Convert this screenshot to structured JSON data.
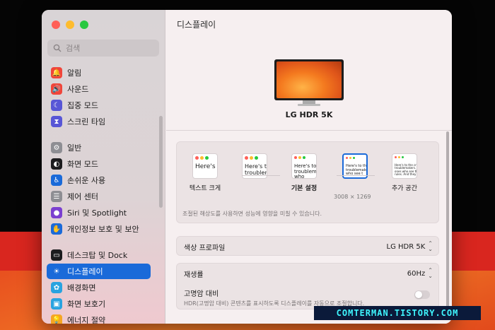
{
  "window": {
    "title": "디스플레이"
  },
  "search": {
    "placeholder": "검색"
  },
  "sidebar": {
    "groups": [
      [
        {
          "label": "알림",
          "icon": "bell-icon",
          "color": "#f0453a"
        },
        {
          "label": "사운드",
          "icon": "speaker-icon",
          "color": "#f0453a"
        },
        {
          "label": "집중 모드",
          "icon": "moon-icon",
          "color": "#5856d6"
        },
        {
          "label": "스크린 타임",
          "icon": "hourglass-icon",
          "color": "#5856d6"
        }
      ],
      [
        {
          "label": "일반",
          "icon": "gear-icon",
          "color": "#8e8e93"
        },
        {
          "label": "화면 모드",
          "icon": "appearance-icon",
          "color": "#1c1c1e"
        },
        {
          "label": "손쉬운 사용",
          "icon": "accessibility-icon",
          "color": "#1a6ad9"
        },
        {
          "label": "제어 센터",
          "icon": "control-center-icon",
          "color": "#8e8e93"
        },
        {
          "label": "Siri 및 Spotlight",
          "icon": "siri-icon",
          "color": "#7b3fd0"
        },
        {
          "label": "개인정보 보호 및 보안",
          "icon": "hand-icon",
          "color": "#1a6ad9"
        }
      ],
      [
        {
          "label": "데스크탑 및 Dock",
          "icon": "dock-icon",
          "color": "#1c1c1e"
        },
        {
          "label": "디스플레이",
          "icon": "sun-icon",
          "color": "#1a6ad9",
          "active": true
        },
        {
          "label": "배경화면",
          "icon": "flower-icon",
          "color": "#29a3e0"
        },
        {
          "label": "화면 보호기",
          "icon": "screensaver-icon",
          "color": "#29a3e0"
        },
        {
          "label": "에너지 절약",
          "icon": "bulb-icon",
          "color": "#f5a623"
        }
      ]
    ]
  },
  "monitor": {
    "name": "LG HDR 5K"
  },
  "resolution": {
    "options": [
      {
        "label": "텍스트 크게",
        "preview": "Here's",
        "bold": false
      },
      {
        "label": "",
        "preview": "Here's to t troublem",
        "bold": false
      },
      {
        "label": "기본 설정",
        "preview": "Here's to t troublema ones who",
        "bold": true
      },
      {
        "label": "",
        "preview": "Here's to the c troublemakers. ones who see t",
        "bold": false,
        "selected": true
      },
      {
        "label": "추가 공간",
        "preview": "Here's to the crazy one troublemakers. The round ones who see things diff rules. And they have no",
        "bold": false
      }
    ],
    "selected_size": "3008 × 1269",
    "note": "조절된 해상도를 사용하면 성능에 영향을 미칠 수 있습니다."
  },
  "color_profile": {
    "label": "색상 프로파일",
    "value": "LG HDR 5K"
  },
  "refresh_rate": {
    "label": "재생률",
    "value": "60Hz"
  },
  "hdr": {
    "label": "고명암 대비",
    "desc": "HDR(고명암 대비) 콘텐츠를 표시하도록 디스플레이를 자동으로 조절합니다.",
    "enabled": false
  },
  "watermark": {
    "text": "COMTERMAN.TISTORY.COM"
  }
}
